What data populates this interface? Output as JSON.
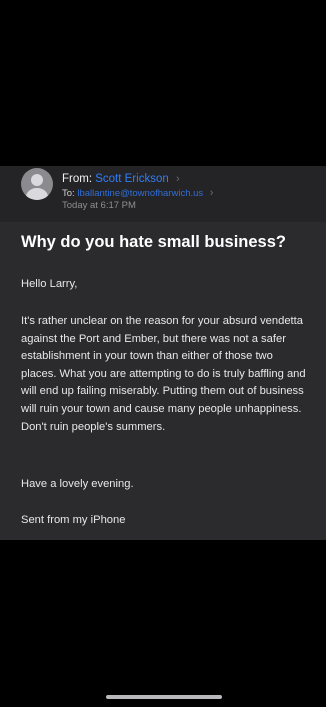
{
  "email": {
    "from_label": "From:",
    "sender_name": "Scott Erickson",
    "to_label": "To:",
    "recipient_address": "lballantine@townofharwich.us",
    "date": "Today at 6:17 PM",
    "subject": "Why do you hate small business?",
    "greeting": "Hello Larry,",
    "body_paragraph": "It's rather unclear on the reason for your absurd vendetta against the Port and Ember, but there was not a safer establishment in your town than either of those two places. What you are attempting to do is truly baffling and will end up failing miserably. Putting them out of business will ruin your town and cause many people unhappiness. Don't ruin people's summers.",
    "closing": "Have a lovely evening.",
    "signature": "Sent from my iPhone"
  },
  "icons": {
    "avatar": "person-avatar-icon",
    "chevron": "chevron-right-icon"
  },
  "colors": {
    "background": "#000000",
    "card": "#2b2b2d",
    "link": "#2f7dfb",
    "secondary_text": "#8e8e93"
  }
}
